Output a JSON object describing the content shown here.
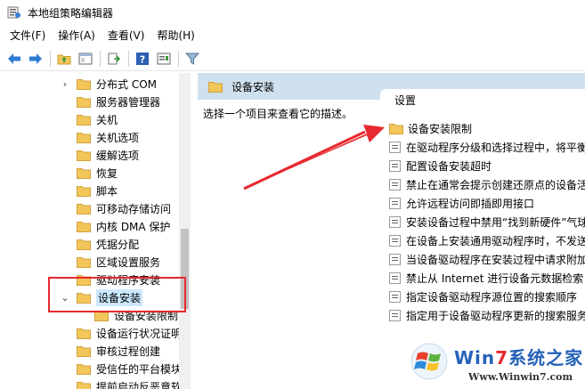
{
  "window": {
    "title": "本地组策略编辑器"
  },
  "menubar": [
    {
      "label": "文件(F)"
    },
    {
      "label": "操作(A)"
    },
    {
      "label": "查看(V)"
    },
    {
      "label": "帮助(H)"
    }
  ],
  "toolbar": {
    "icons": [
      "back-arrow-icon",
      "forward-arrow-icon",
      "up-folder-icon",
      "show-hide-tree-icon",
      "export-list-icon",
      "help-icon",
      "properties-icon",
      "filter-icon"
    ]
  },
  "tree": {
    "items": [
      {
        "label": "分布式 COM",
        "expander": "›"
      },
      {
        "label": "服务器管理器"
      },
      {
        "label": "关机"
      },
      {
        "label": "关机选项"
      },
      {
        "label": "缓解选项"
      },
      {
        "label": "恢复"
      },
      {
        "label": "脚本"
      },
      {
        "label": "可移动存储访问"
      },
      {
        "label": "内核 DMA 保护"
      },
      {
        "label": "凭据分配"
      },
      {
        "label": "区域设置服务"
      },
      {
        "label": "驱动程序安装"
      },
      {
        "label": "设备安装",
        "expander": "⌄",
        "selected": true
      },
      {
        "label": "设备安装限制"
      },
      {
        "label": "设备运行状况证明"
      },
      {
        "label": "审核过程创建"
      },
      {
        "label": "受信任的平台模块"
      },
      {
        "label": "提前启动反恶意软"
      }
    ]
  },
  "right": {
    "header": "设备安装",
    "description": "选择一个项目来查看它的描述。",
    "column_header": "设置",
    "items": [
      {
        "label": "设备安装限制",
        "kind": "folder"
      },
      {
        "label": "在驱动程序分级和选择过程中，将平衡",
        "kind": "setting"
      },
      {
        "label": "配置设备安装超时",
        "kind": "setting"
      },
      {
        "label": "禁止在通常会提示创建还原点的设备活",
        "kind": "setting"
      },
      {
        "label": "允许远程访问即插即用接口",
        "kind": "setting"
      },
      {
        "label": "安装设备过程中禁用“找到新硬件”气球",
        "kind": "setting"
      },
      {
        "label": "在设备上安装通用驱动程序时，不发送",
        "kind": "setting"
      },
      {
        "label": "当设备驱动程序在安装过程中请求附加",
        "kind": "setting"
      },
      {
        "label": "禁止从 Internet 进行设备元数据检索",
        "kind": "setting"
      },
      {
        "label": "指定设备驱动程序源位置的搜索顺序",
        "kind": "setting"
      },
      {
        "label": "指定用于设备驱动程序更新的搜索服务",
        "kind": "setting"
      }
    ]
  },
  "watermark": {
    "brand_pre": "Win",
    "brand_seven": "7",
    "brand_post": "系统之家",
    "url": "Www.Winwin7.com"
  },
  "colors": {
    "selection": "#cce8ff",
    "header_bg": "#cfe0ee",
    "highlight_red": "#e8282e",
    "folder": "#f3c65a"
  }
}
